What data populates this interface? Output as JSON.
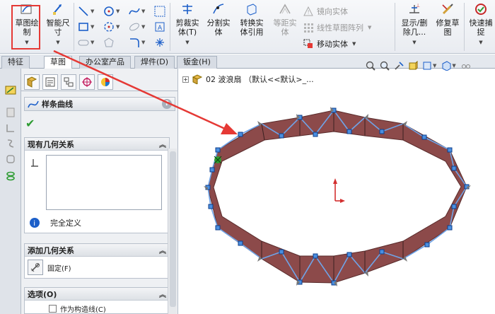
{
  "ribbon": {
    "sketch": "草图绘\n制",
    "smart_dimension": "智能尺\n寸",
    "trim": "剪裁实\n体(T)",
    "split": "分割实\n体",
    "convert": "转换实\n体引用",
    "offset": "等距实\n体",
    "mirror": "镜向实体",
    "linear_pattern": "线性草图阵列",
    "move": "移动实体",
    "show_delete": "显示/删\n除几...",
    "repair": "修复草\n图",
    "quick_snap": "快速捕\n捉"
  },
  "tabs": [
    "特征",
    "草图",
    "办公室产品",
    "焊件(D)",
    "钣金(H)"
  ],
  "active_tab": "草图",
  "tree": {
    "item": "02 波浪扇 （默认<<默认>_..."
  },
  "pm": {
    "title": "样条曲线",
    "existing_relations": "现有几何关系",
    "status": "完全定义",
    "add_relations": "添加几何关系",
    "fixed": "固定(F)",
    "options": "选项(O)",
    "construction": "作为构造线(C)"
  },
  "colors": {
    "accent": "#e53935",
    "blade": "#8c4a4a",
    "edge": "#6fa4e8",
    "ok_green": "#2e9c32"
  },
  "icons": [
    "sketch-icon",
    "smart-dimension-icon",
    "line-icon",
    "rectangle-icon",
    "circle-icon",
    "spline-icon",
    "trim-icon",
    "split-icon",
    "convert-icon",
    "offset-icon",
    "mirror-icon",
    "pattern-icon",
    "move-icon",
    "show-delete-icon",
    "repair-icon",
    "quick-snap-icon",
    "help-icon",
    "checkmark-icon",
    "info-icon",
    "fixed-icon"
  ]
}
